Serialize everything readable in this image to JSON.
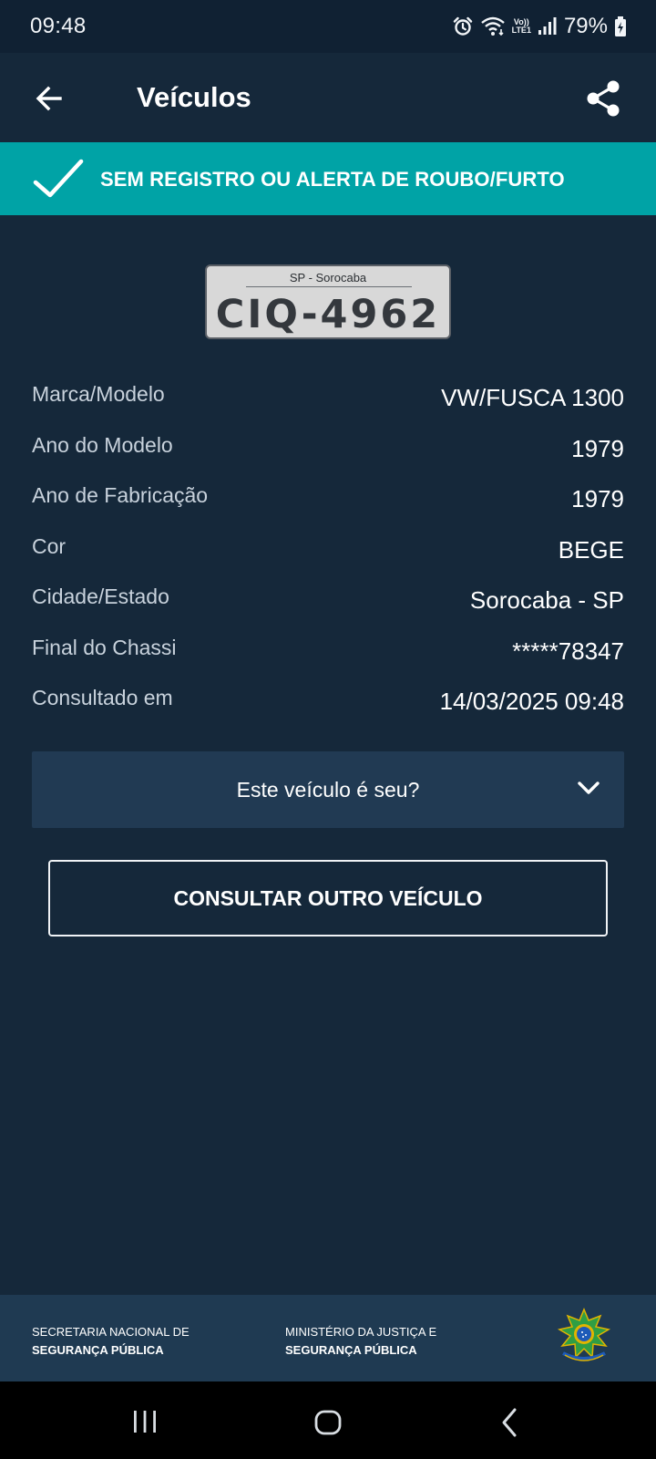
{
  "status_bar": {
    "time": "09:48",
    "network_label_top": "Vo))",
    "network_label_bottom": "LTE1",
    "battery": "79%",
    "icons": [
      "alarm-icon",
      "wifi-icon",
      "lte-icon",
      "signal-icon",
      "battery-charging-icon"
    ]
  },
  "app_bar": {
    "title": "Veículos",
    "back_icon": "arrow-left-icon",
    "share_icon": "share-icon"
  },
  "alert": {
    "text": "SEM REGISTRO OU ALERTA DE ROUBO/FURTO",
    "icon": "checkmark-icon",
    "color": "#00a3a6"
  },
  "plate": {
    "location": "SP - Sorocaba",
    "number": "CIQ-4962"
  },
  "vehicle_info": [
    {
      "label": "Marca/Modelo",
      "value": "VW/FUSCA 1300"
    },
    {
      "label": "Ano do Modelo",
      "value": "1979"
    },
    {
      "label": "Ano de Fabricação",
      "value": "1979"
    },
    {
      "label": "Cor",
      "value": "BEGE"
    },
    {
      "label": "Cidade/Estado",
      "value": "Sorocaba - SP"
    },
    {
      "label": "Final do Chassi",
      "value": "*****78347"
    },
    {
      "label": "Consultado em",
      "value": "14/03/2025 09:48"
    }
  ],
  "ownership_dropdown": {
    "label": "Este veículo é seu?",
    "icon": "chevron-down-icon"
  },
  "consult_button": {
    "label": "CONSULTAR OUTRO VEÍCULO"
  },
  "footer": {
    "left_line1": "SECRETARIA NACIONAL DE",
    "left_line2": "SEGURANÇA PÚBLICA",
    "right_line1": "MINISTÉRIO DA JUSTIÇA E",
    "right_line2": "SEGURANÇA PÚBLICA",
    "emblem_icon": "coat-of-arms-icon"
  },
  "colors": {
    "background": "#15283a",
    "status_bar": "#102133",
    "dropdown": "#213a53",
    "footer": "#1f3a52",
    "accent": "#00a3a6"
  }
}
